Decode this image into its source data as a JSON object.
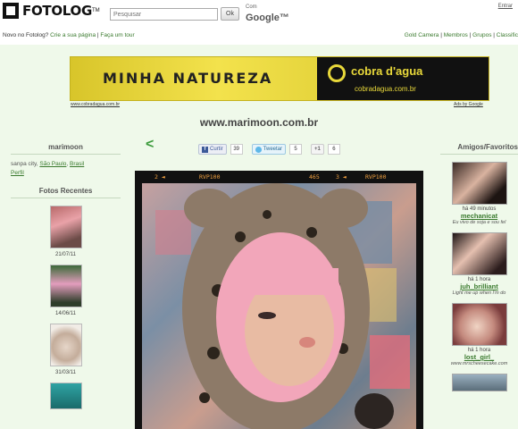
{
  "header": {
    "logo_text": "FOTOLOG",
    "logo_tm": "TM",
    "search_placeholder": "Pesquisar",
    "search_button": "Ok",
    "google_prefix": "Com",
    "google_label": "Google™",
    "login": "Entrar"
  },
  "subbar": {
    "new_question": "Novo no Fotolog?",
    "create_page": "Crie a sua página",
    "separator": "|",
    "tour": "Faça um tour",
    "links": [
      "Gold Camera",
      "Membros",
      "Grupos",
      "Classific"
    ]
  },
  "banner": {
    "title": "MINHA NATUREZA",
    "brand": "cobra d'agua",
    "url": "cobradagua.com.br",
    "footer_link": "www.cobradagua.com.br",
    "ads_by": "Ads by Google"
  },
  "site_title": "www.marimoon.com.br",
  "profile": {
    "username": "marimoon",
    "location_prefix": "sanpa city,",
    "city": "São Paulo",
    "country": "Brasil",
    "profile_link": "Perfil"
  },
  "recent": {
    "heading": "Fotos Recentes",
    "items": [
      {
        "date": "21/07/11"
      },
      {
        "date": "14/06/11"
      },
      {
        "date": "31/03/11"
      }
    ]
  },
  "social": {
    "prev": "<",
    "fb_label": "Curtir",
    "fb_count": "39",
    "tw_label": "Tweetar",
    "tw_count": "5",
    "gp_label": "+1",
    "gp_count": "6"
  },
  "photo": {
    "film_labels": [
      "2 ◄",
      "RVP100",
      "465",
      "3 ◄",
      "RVP100"
    ]
  },
  "friends": {
    "heading": "Amigos/Favoritos",
    "items": [
      {
        "time": "há 49 minutos",
        "name": "mechanicat",
        "caption": "Eu vivo de soja e sou fel"
      },
      {
        "time": "há 1 hora",
        "name": "juh_brilliant",
        "caption": "Light me up when I'm do"
      },
      {
        "time": "há 1 hora",
        "name": "lost_girl_",
        "caption": "www.mrscheesecake.com"
      }
    ]
  },
  "colors": {
    "page_bg": "#eff9ea",
    "link_green": "#3a7a2e",
    "banner_yellow": "#e8d83a"
  }
}
